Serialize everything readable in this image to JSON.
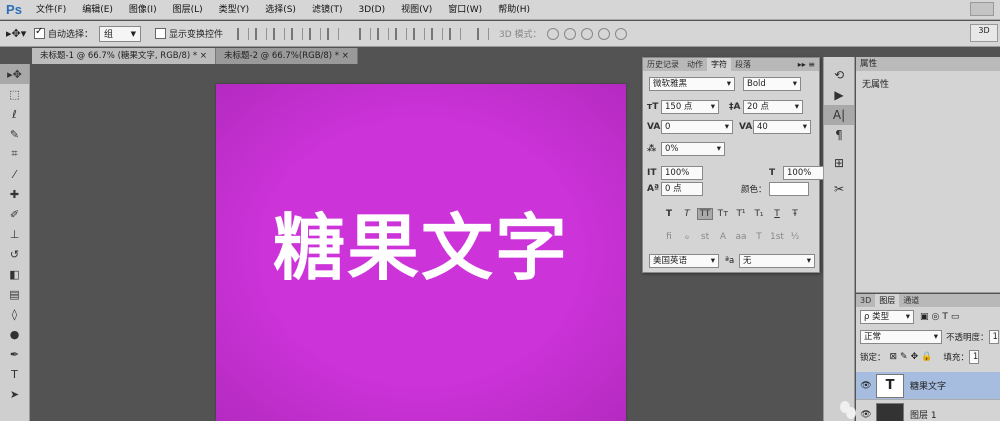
{
  "app": {
    "logo": "Ps"
  },
  "menu": [
    "文件(F)",
    "编辑(E)",
    "图像(I)",
    "图层(L)",
    "类型(Y)",
    "选择(S)",
    "滤镜(T)",
    "3D(D)",
    "视图(V)",
    "窗口(W)",
    "帮助(H)"
  ],
  "options": {
    "auto_select_label": "自动选择：",
    "auto_select_value": "组",
    "show_transform_label": "显示变换控件",
    "mode_label": "3D 模式：",
    "btn_3d": "3D"
  },
  "tabs": [
    {
      "label": "未标题-1 @ 66.7% (糖果文字, RGB/8) * ×",
      "active": true
    },
    {
      "label": "未标题-2 @ 66.7%(RGB/8) * ×",
      "active": false
    }
  ],
  "canvas": {
    "text": "糖果文字",
    "color": "#cc33d9"
  },
  "char_panel": {
    "tabs": [
      "历史记录",
      "动作",
      "字符",
      "段落"
    ],
    "font_family": "微软雅黑",
    "font_style": "Bold",
    "size": "150 点",
    "leading": "20 点",
    "kerning": "0",
    "tracking": "40",
    "scale_pct": "0%",
    "vert_scale": "100%",
    "horiz_scale": "100%",
    "baseline": "0 点",
    "color_label": "颜色：",
    "style_buttons": [
      "T",
      "T",
      "TT",
      "Tт",
      "T¹",
      "T₁",
      "T",
      "Ŧ"
    ],
    "ot_buttons": [
      "fi",
      "ℴ",
      "st",
      "A",
      "aa",
      "T",
      "1st",
      "½"
    ],
    "language": "美国英语",
    "aa_label": "ªa",
    "aa_value": "无"
  },
  "props_panel": {
    "tab": "属性",
    "text": "无属性"
  },
  "layers_panel": {
    "tabs": [
      "3D",
      "图层",
      "通道"
    ],
    "filter_label": "ρ 类型",
    "blend_mode": "正常",
    "opacity_label": "不透明度：",
    "opacity_value": "1",
    "lock_label": "锁定：",
    "fill_label": "填充：",
    "fill_value": "1",
    "layers": [
      {
        "name": "糖果文字",
        "selected": true,
        "thumb": "T"
      },
      {
        "name": "图层 1",
        "selected": false,
        "thumb": ""
      }
    ]
  }
}
